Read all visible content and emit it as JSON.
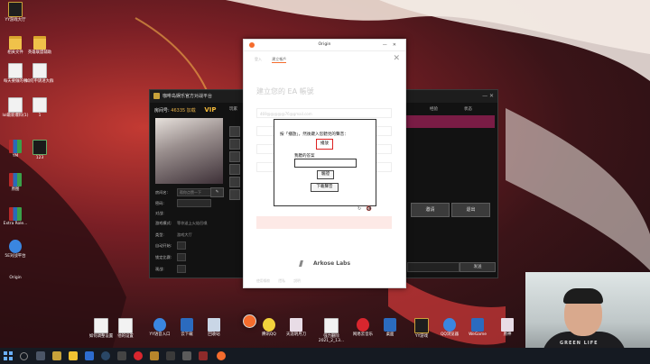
{
  "desktop": {
    "icons_left": [
      {
        "label": "YY游戏大厅",
        "kind": "vip"
      },
      {
        "label": "相关文件",
        "kind": "doc"
      },
      {
        "label": "英雄联盟辅助",
        "kind": "doc"
      },
      {
        "label": "每天要做的事",
        "kind": "doc"
      },
      {
        "label": "如何申请进大群",
        "kind": "doc"
      },
      {
        "label": "lol最新爆料(1)",
        "kind": "doc"
      },
      {
        "label": "1",
        "kind": "doc"
      },
      {
        "label": "YM",
        "kind": "rar"
      },
      {
        "label": "123",
        "kind": "green"
      },
      {
        "label": "原图",
        "kind": "rar"
      },
      {
        "label": "Extra Role...",
        "kind": "rar"
      },
      {
        "label": "5E对战平台",
        "kind": "blue"
      },
      {
        "label": "Origin",
        "kind": "origin"
      }
    ],
    "icons_bottom": [
      {
        "label": "如何调整设置",
        "kind": "doc"
      },
      {
        "label": "他的设置",
        "kind": "doc"
      },
      {
        "label": "YY语音入口",
        "kind": "blue"
      },
      {
        "label": "云下载",
        "kind": "app"
      },
      {
        "label": "回收站",
        "kind": "recycle"
      },
      {
        "label": "腾讯QQ",
        "kind": "q"
      },
      {
        "label": "天涯明月刀",
        "kind": "pink"
      },
      {
        "label": "强力删除2021_2_13...",
        "kind": "doc"
      },
      {
        "label": "网易云音乐",
        "kind": "red"
      },
      {
        "label": "桌面",
        "kind": "app"
      },
      {
        "label": "YY游戏",
        "kind": "vip"
      },
      {
        "label": "QQ浏览器",
        "kind": "blue"
      },
      {
        "label": "WeGame",
        "kind": "app"
      },
      {
        "label": "原神",
        "kind": "pink"
      }
    ]
  },
  "platform": {
    "title": "咖啡岛娱乐官方对战平台",
    "id_label": "房间号:",
    "id_value": "46335",
    "id_suffix": "加载",
    "vip": "VIP",
    "rows": [
      {
        "label": "房间名:",
        "value": "帮你点赞一下"
      },
      {
        "label": "密码:",
        "value": ""
      },
      {
        "label": "对战:",
        "value": ""
      },
      {
        "label": "游戏模式:",
        "value": "等你送上火焰召唤"
      },
      {
        "label": "类型:",
        "value": "游戏大厅"
      },
      {
        "label": "自动开始:",
        "value": ""
      },
      {
        "label": "锁定比赛:",
        "value": ""
      },
      {
        "label": "观战:",
        "value": ""
      }
    ],
    "columns": [
      "玩家",
      "经验",
      "状态"
    ],
    "buttons": [
      "邀请",
      "退出"
    ],
    "send_label": "发送"
  },
  "origin": {
    "window_title": "Origin",
    "tabs": [
      "登入",
      "建立帳戶"
    ],
    "heading": "建立您的 EA 帳號",
    "fields": [
      "469@@@@@76@gmail.com",
      "",
      "",
      ""
    ],
    "branding": "Arkose Labs",
    "footer_links": [
      "使用條款",
      "隱私",
      "說明"
    ]
  },
  "captcha": {
    "prompt": "按「播放」，然後鍵入您聽見的聲音：",
    "play_label": "播放",
    "answer_label": "我聽的答案",
    "answer_value": "",
    "verify_label": "驗證",
    "download_label": "下載聲音"
  },
  "webcam": {
    "shirt_text": "GREEN LIFE"
  }
}
